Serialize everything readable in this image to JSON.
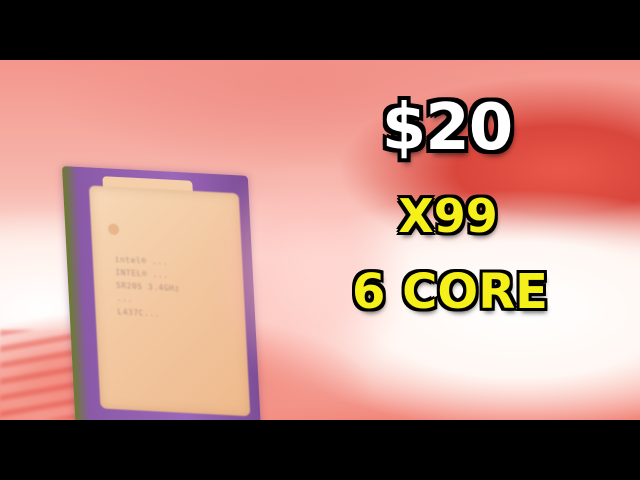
{
  "thumbnail": {
    "headline_price": "$20",
    "headline_platform": "X99",
    "headline_cores": "6 CORE",
    "price_color": "#ffffff",
    "highlight_color": "#f5ef1a",
    "outline_color": "#000000"
  },
  "cpu_chip": {
    "markings": [
      "intel® ...",
      "INTEL® ...",
      "SR20S 3.4GHz",
      "...",
      "L437C..."
    ]
  }
}
